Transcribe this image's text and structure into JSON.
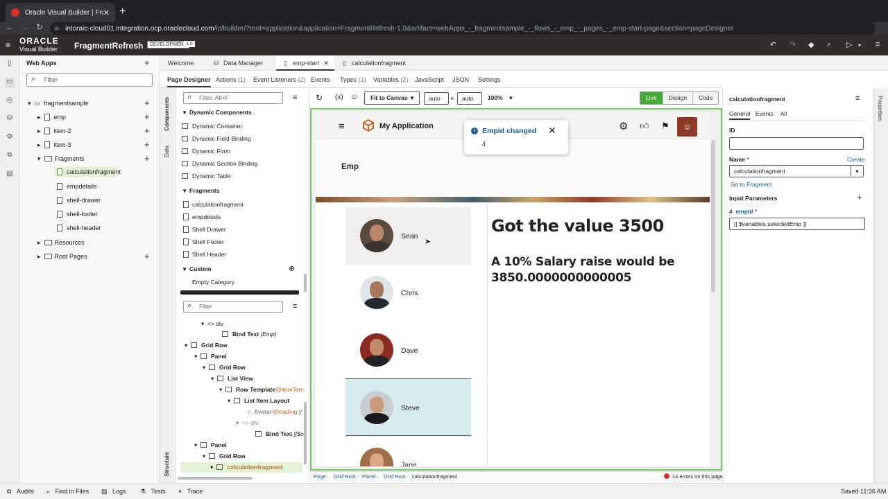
{
  "browser": {
    "tab_title": "Oracle Visual Builder | Fragme",
    "url_host": "intoraic-cloud01.integration.ocp.oraclecloud.com",
    "url_path": "/ic/builder/?root=application&application=FragmentRefresh-1.0&artifact=webApps_-_fragmentsample_-_flows_-_emp_-_pages_-_emp-start-page&section=pageDesigner"
  },
  "vb_header": {
    "brand_oracle": "ORACLE",
    "brand_product": "Visual Builder",
    "app_name": "FragmentRefresh",
    "env_badge": "DEVELOPMENT",
    "version_badge": "1.0"
  },
  "web_apps": {
    "title": "Web Apps",
    "filter_placeholder": "Filter",
    "tree": [
      {
        "label": "fragmentsample"
      },
      {
        "label": "emp"
      },
      {
        "label": "item-2"
      },
      {
        "label": "item-3"
      },
      {
        "label": "Fragments"
      },
      {
        "label": "calculationfragment"
      },
      {
        "label": "empdetails"
      },
      {
        "label": "shell-drawer"
      },
      {
        "label": "shell-footer"
      },
      {
        "label": "shell-header"
      },
      {
        "label": "Resources"
      },
      {
        "label": "Root Pages"
      }
    ]
  },
  "editor_tabs": [
    "Welcome",
    "Data Manager",
    "emp-start",
    "calculationfragment"
  ],
  "sub_tabs": {
    "page_designer": "Page Designer",
    "actions": "Actions",
    "actions_count": "(1)",
    "event_listeners": "Event Listeners",
    "event_listeners_count": "(2)",
    "events": "Events",
    "types": "Types",
    "types_count": "(1)",
    "variables": "Variables",
    "variables_count": "(2)",
    "javascript": "JavaScript",
    "json": "JSON",
    "settings": "Settings"
  },
  "components": {
    "rail_components": "Components",
    "rail_data": "Data",
    "rail_structure": "Structure",
    "filter_placeholder": "Filter, Alt+F",
    "dynamic_header": "Dynamic Components",
    "dynamic_items": [
      "Dynamic Container",
      "Dynamic Field Binding",
      "Dynamic Form",
      "Dynamic Section Binding",
      "Dynamic Table"
    ],
    "fragments_header": "Fragments",
    "fragment_items": [
      "calculationfragment",
      "empdetails",
      "Shell Drawer",
      "Shell Footer",
      "Shell Header"
    ],
    "custom_header": "Custom",
    "custom_items": [
      "Empty Category"
    ]
  },
  "structure": {
    "filter_placeholder": "Filter",
    "div": "div",
    "bind_text": "Bind Text",
    "bind_text_emp": "(Emp)",
    "grid_row": "Grid Row",
    "panel": "Panel",
    "list_view": "List View",
    "row_template": "Row Template",
    "row_template_slot": "@itemTem",
    "list_item_layout": "List Item Layout",
    "avatar": "Avatar",
    "avatar_slot": "@leading",
    "avatar_val": "[[",
    "bind_text_cu": "[[$cu",
    "calculationfragment": "calculationfragment"
  },
  "canvas_toolbar": {
    "fit": "Fit to Canvas",
    "width": "auto",
    "height": "auto",
    "times": "×",
    "zoom": "100%",
    "modes": [
      "Live",
      "Design",
      "Code"
    ]
  },
  "preview": {
    "app_title": "My Application",
    "page_title": "Emp",
    "employees": [
      "Sean",
      "Chris",
      "Dave",
      "Steve",
      "Jane"
    ],
    "result_title": "Got the value 3500",
    "result_text": "A 10% Salary raise would be 3850.0000000000005",
    "toast_title": "Empid changed",
    "toast_message": "4"
  },
  "breadcrumbs": [
    "Page",
    "Grid Row",
    "Panel",
    "Grid Row",
    "calculationfragment"
  ],
  "errors_text": "14 errors on this page",
  "properties": {
    "title": "calculationfragment",
    "tabs": [
      "General",
      "Events",
      "All"
    ],
    "rail_label": "Properties",
    "id_label": "ID",
    "id_value": "",
    "name_label": "Name",
    "create_link": "Create",
    "name_value": "calculationfragment",
    "goto_link": "Go to Fragment",
    "input_params_label": "Input Parameters",
    "param_name": "empid",
    "param_value": "[[ $variables.selectedEmp ]]"
  },
  "status_bar": {
    "audits": "Audits",
    "find_in_files": "Find in Files",
    "logs": "Logs",
    "tests": "Tests",
    "trace": "Trace",
    "saved": "Saved 11:36 AM"
  }
}
